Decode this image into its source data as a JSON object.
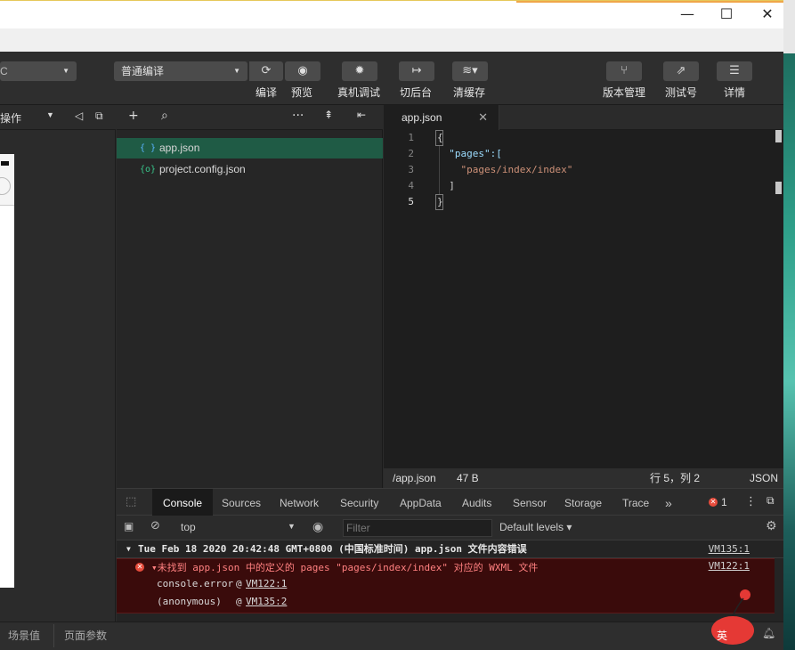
{
  "toolbar": {
    "compile_mode": "普通编译",
    "buttons": [
      {
        "label": "编译"
      },
      {
        "label": "预览"
      },
      {
        "label": "真机调试"
      },
      {
        "label": "切后台"
      },
      {
        "label": "清缓存"
      },
      {
        "label": "版本管理"
      },
      {
        "label": "测试号"
      },
      {
        "label": "详情"
      }
    ]
  },
  "simulator": {
    "ops_label": "操作"
  },
  "files": [
    {
      "icon": "{ }",
      "name": "app.json"
    },
    {
      "icon": "{o}",
      "name": "project.config.json"
    }
  ],
  "editor": {
    "tab": "app.json",
    "lines": [
      {
        "n": "1",
        "text": "{"
      },
      {
        "n": "2",
        "text": "  \"pages\":["
      },
      {
        "n": "3",
        "text": "    \"pages/index/index\""
      },
      {
        "n": "4",
        "text": "  ]"
      },
      {
        "n": "5",
        "text": "}"
      }
    ],
    "status": {
      "path": "/app.json",
      "size": "47 B",
      "cursor": "行 5，列 2",
      "lang": "JSON"
    }
  },
  "devtools": {
    "tabs": [
      "Console",
      "Sources",
      "Network",
      "Security",
      "AppData",
      "Audits",
      "Sensor",
      "Storage",
      "Trace"
    ],
    "more": "»",
    "error_count": "1",
    "context": "top",
    "filter_placeholder": "Filter",
    "levels": "Default levels",
    "log_group": {
      "text": "Tue Feb 18 2020 20:42:48 GMT+0800 (中国标准时间) app.json 文件内容错误",
      "source": "VM135:1"
    },
    "error": {
      "text": "▾未找到 app.json 中的定义的 pages \"pages/index/index\" 对应的 WXML 文件",
      "source": "VM122:1",
      "trace": [
        {
          "fn": "console.error",
          "src": "VM122:1"
        },
        {
          "fn": "(anonymous)",
          "src": "VM135:2"
        }
      ]
    }
  },
  "bottom": {
    "scene": "场景值",
    "params": "页面参数"
  },
  "mascot": {
    "char": "英"
  }
}
